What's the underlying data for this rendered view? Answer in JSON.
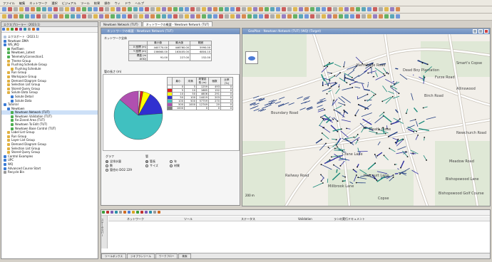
{
  "menu": [
    "ファイル",
    "編集",
    "ネットワーク",
    "選択",
    "ビジュアル",
    "ツール",
    "結果",
    "操作",
    "ウィ",
    "ドウ",
    "ヘルプ"
  ],
  "tree": {
    "header": "エクスプローラー（2023.1）",
    "items": [
      {
        "label": "エクスポート（2023.1）",
        "depth": 0,
        "color": "#b0c4de"
      },
      {
        "label": "Newtown DMA",
        "depth": 0,
        "color": "#3a7bd5"
      },
      {
        "label": "WS_WQ",
        "depth": 0,
        "color": "#3a7bd5"
      },
      {
        "label": "RedTown",
        "depth": 1,
        "color": "#4caf50"
      },
      {
        "label": "Newtown_Latest",
        "depth": 1,
        "color": "#4caf50"
      },
      {
        "label": "TelemetryConnection1",
        "depth": 1,
        "color": "#4caf50"
      },
      {
        "label": "Theme Group",
        "depth": 1,
        "color": "#e0b040"
      },
      {
        "label": "Flushing Schedule Group",
        "depth": 1,
        "color": "#e0b040"
      },
      {
        "label": "Flushing Schedule",
        "depth": 2,
        "color": "#e0b040"
      },
      {
        "label": "Run Group",
        "depth": 1,
        "color": "#e0b040"
      },
      {
        "label": "Workspace Group",
        "depth": 1,
        "color": "#e0b040"
      },
      {
        "label": "Demand Diagram Group",
        "depth": 1,
        "color": "#e0b040"
      },
      {
        "label": "Selection List Group",
        "depth": 1,
        "color": "#e0b040"
      },
      {
        "label": "Stored Query Group",
        "depth": 1,
        "color": "#e0b040"
      },
      {
        "label": "Solute Data Group",
        "depth": 1,
        "color": "#e0b040"
      },
      {
        "label": "Solute Detail",
        "depth": 2,
        "color": "#3a7bd5"
      },
      {
        "label": "Solute Data",
        "depth": 2,
        "color": "#3a7bd5"
      },
      {
        "label": "Tutorial",
        "depth": 0,
        "color": "#3a7bd5"
      },
      {
        "label": "Newtown",
        "depth": 1,
        "color": "#3a7bd5"
      },
      {
        "label": "Newtown Network (TUT)",
        "depth": 2,
        "color": "#4caf50",
        "selected": true
      },
      {
        "label": "Newtown Validation (TUT)",
        "depth": 2,
        "color": "#4caf50"
      },
      {
        "label": "Re-Zoned Area (TUT)",
        "depth": 2,
        "color": "#4caf50"
      },
      {
        "label": "Newtown To Edit (TUT)",
        "depth": 2,
        "color": "#4caf50"
      },
      {
        "label": "Newtown Base Control (TUT)",
        "depth": 2,
        "color": "#4caf50"
      },
      {
        "label": "Label List Group",
        "depth": 1,
        "color": "#e0b040"
      },
      {
        "label": "Run Group",
        "depth": 1,
        "color": "#e0b040"
      },
      {
        "label": "Layer List Group",
        "depth": 1,
        "color": "#e0b040"
      },
      {
        "label": "Demand Diagram Group",
        "depth": 1,
        "color": "#e0b040"
      },
      {
        "label": "Selection List Group",
        "depth": 1,
        "color": "#e0b040"
      },
      {
        "label": "Stored Query Group",
        "depth": 1,
        "color": "#e0b040"
      },
      {
        "label": "Control Examples",
        "depth": 0,
        "color": "#3a7bd5"
      },
      {
        "label": "UPC",
        "depth": 0,
        "color": "#3a7bd5"
      },
      {
        "label": "WQ",
        "depth": 0,
        "color": "#3a7bd5"
      },
      {
        "label": "Advanced Course Start",
        "depth": 0,
        "color": "#3a7bd5"
      },
      {
        "label": "Recycle Bin",
        "depth": 0,
        "color": "#999999"
      }
    ]
  },
  "tabs": [
    "Newtown Network (TUT)",
    "ネットワークの概要 - Newtown Network (TUT)"
  ],
  "summary": {
    "title": "ネットワークの概要 - Newtown Network (TUT)",
    "group1_label": "ネットワーク全体",
    "headers": [
      "最小値",
      "最大値",
      "範囲"
    ],
    "rows": [
      {
        "label": "X 座標 (m)",
        "vals": [
          "440770.00",
          "446760.00",
          "5990.00"
        ]
      },
      {
        "label": "Y 座標 (m)",
        "vals": [
          "156660.00",
          "163405.00",
          "6804.10"
        ]
      },
      {
        "label": "標高 (m AOD)",
        "vals": [
          "91.00",
          "227.00",
          "152.00"
        ]
      }
    ],
    "pipe_label": "管の長さ (m)",
    "pipe_headers": [
      "最小",
      "未満",
      "総管延長 (m)",
      "個数",
      "比率 (%)"
    ],
    "pipe_rows": [
      [
        "",
        "0",
        "5",
        "1259",
        "493",
        "0"
      ],
      [
        "",
        "5",
        "10",
        "1685",
        "152",
        "0"
      ],
      [
        "",
        "10",
        "50",
        "4606",
        "291",
        "0"
      ],
      [
        "",
        "50",
        "100",
        "14419",
        "203",
        "0"
      ],
      [
        "",
        "100",
        "500",
        "57759",
        "270",
        "0"
      ],
      [
        "",
        "500",
        "1000",
        "12749",
        "20",
        "0"
      ],
      [
        "",
        "1000",
        "",
        "0",
        "0",
        "0"
      ]
    ],
    "pie_colors": [
      "#ffffff",
      "#e02020",
      "#ffff00",
      "#3030d0",
      "#40c0c0",
      "#b050b0",
      "#808080"
    ],
    "chart_group_label": "グラフ",
    "chart_options": [
      "全排水量",
      "数",
      "管径の DO2 229"
    ],
    "pipe_group_label": "管",
    "pipe_options": [
      "管長",
      "年",
      "サイズ",
      "材質"
    ]
  },
  "geoplan": {
    "title": "GeoPlan - Newtown Network (TUT) (WQ) (Target)",
    "scale": "200 m",
    "roads": [
      "Dead Boy Plantation",
      "Smart's Copse",
      "Furze Road",
      "Birch Road",
      "Allinswood",
      "Hermitage Road",
      "Newchurch Road",
      "Harcourt Lane",
      "Meadow Road",
      "Bishopswood Lane",
      "Bishopswood Golf Course",
      "Heath Close",
      "Boundary Road",
      "Millbrook Lane",
      "Copse",
      "Crane Lane",
      "Railway Road"
    ]
  },
  "results": {
    "headers": [
      "ネットワーク",
      "ツール",
      "ステータス",
      "Validation",
      "ランの実行ドキュメント"
    ],
    "side_label": "ステータスバー",
    "footer_tabs": [
      "ツールボックス",
      "ジオプランツール",
      "ワークフロー",
      "検索"
    ]
  }
}
